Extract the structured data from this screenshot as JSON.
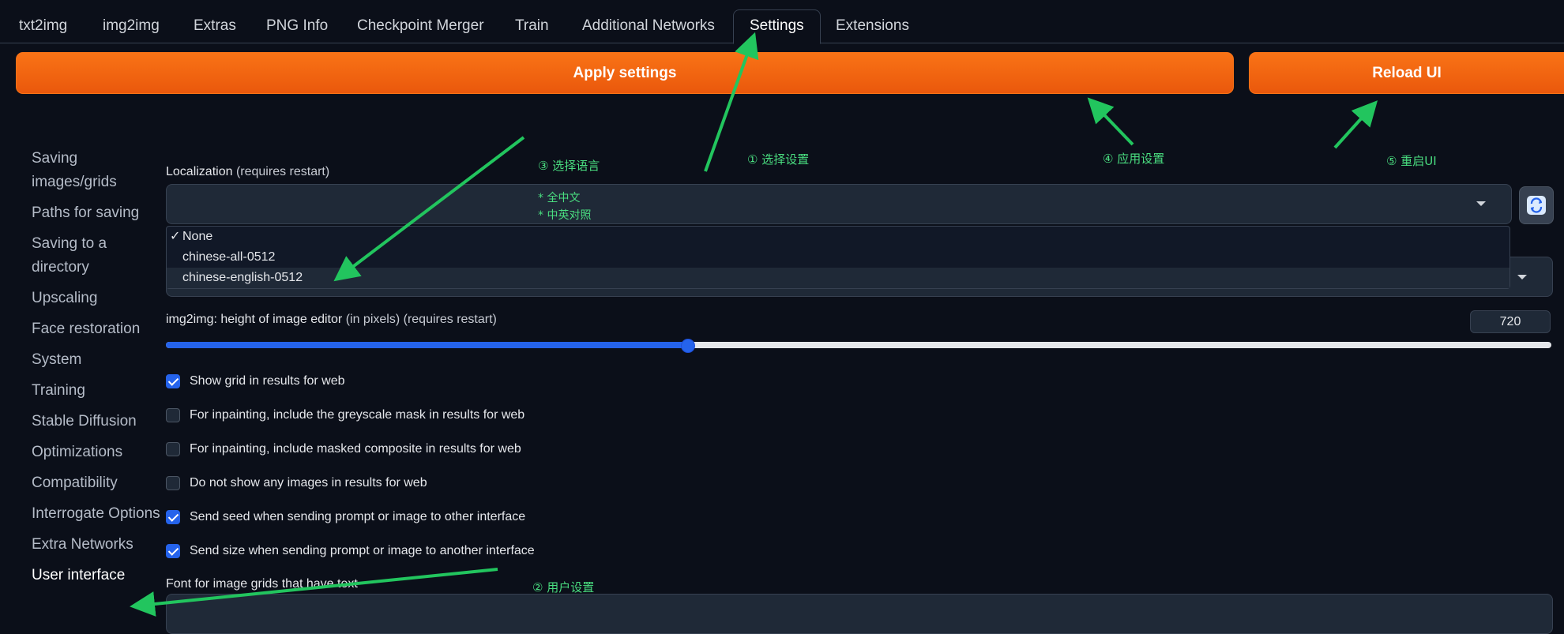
{
  "tabs": [
    "txt2img",
    "img2img",
    "Extras",
    "PNG Info",
    "Checkpoint Merger",
    "Train",
    "Additional Networks",
    "Settings",
    "Extensions"
  ],
  "buttons": {
    "apply": "Apply settings",
    "reload": "Reload UI"
  },
  "sidebar": [
    "Saving images/grids",
    "Paths for saving",
    "Saving to a directory",
    "Upscaling",
    "Face restoration",
    "System",
    "Training",
    "Stable Diffusion",
    "Optimizations",
    "Compatibility",
    "Interrogate Options",
    "Extra Networks",
    "User interface"
  ],
  "localization": {
    "label": "Localization",
    "note": "(requires restart)",
    "options": [
      "None",
      "chinese-all-0512",
      "chinese-english-0512"
    ],
    "selected": "None",
    "check": "✓"
  },
  "img2img_height": {
    "label": "img2img: height of image editor",
    "unit": "(in pixels)",
    "note": "(requires restart)",
    "value": "720",
    "fraction": 0.376
  },
  "checkboxes": [
    {
      "label": "Show grid in results for web",
      "checked": true
    },
    {
      "label": "For inpainting, include the greyscale mask in results for web",
      "checked": false
    },
    {
      "label": "For inpainting, include masked composite in results for web",
      "checked": false
    },
    {
      "label": "Do not show any images in results for web",
      "checked": false
    },
    {
      "label": "Send seed when sending prompt or image to other interface",
      "checked": true
    },
    {
      "label": "Send size when sending prompt or image to another interface",
      "checked": true
    }
  ],
  "font_grid": {
    "label": "Font for image grids that have text"
  },
  "annotations": {
    "step1": "① 选择设置",
    "step2": "② 用户设置",
    "step3": "③ 选择语言",
    "step4": "④ 应用设置",
    "step5": "⑤ 重启UI",
    "lang1": "* 全中文",
    "lang2": "* 中英对照"
  },
  "colors": {
    "accent": "#f97316",
    "annotation": "#22c55e",
    "slider": "#2563eb",
    "background": "#0b0f19"
  },
  "icons": {
    "refresh": "refresh-icon",
    "caret": "chevron-down-icon",
    "check": "checkmark-icon"
  }
}
